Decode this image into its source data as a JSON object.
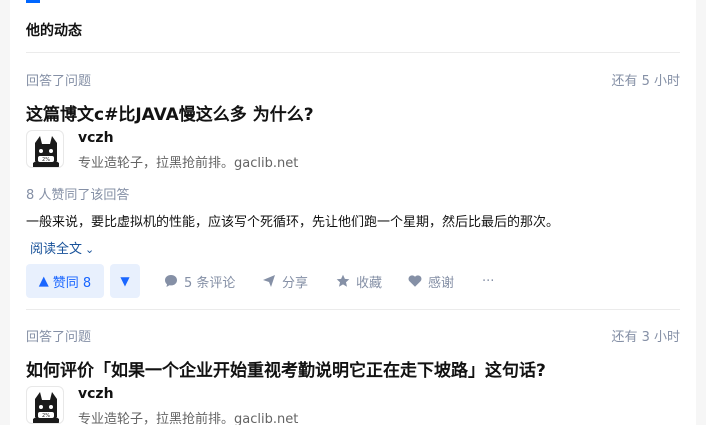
{
  "section": {
    "title": "他的动态"
  },
  "feed": [
    {
      "action": "回答了问题",
      "time": "还有 5 小时",
      "question": "这篇博文c#比JAVA慢这么多 为什么?",
      "author": {
        "name": "vczh",
        "bio": "专业造轮子，拉黑抢前排。gaclib.net",
        "avatar_icon": "cat-avatar-icon"
      },
      "votes_text": "8 人赞同了该回答",
      "excerpt": "一般来说，要比虚拟机的性能，应该写个死循环，先让他们跑一个星期，然后比最后的那次。",
      "read_more": "阅读全文",
      "upvote_label": "赞同 8",
      "comments_label": "5 条评论",
      "share_label": "分享",
      "favorite_label": "收藏",
      "thanks_label": "感谢",
      "more_label": "···"
    },
    {
      "action": "回答了问题",
      "time": "还有 3 小时",
      "question": "如何评价「如果一个企业开始重视考勤说明它正在走下坡路」这句话?",
      "author": {
        "name": "vczh",
        "bio": "专业造轮子，拉黑抢前排。gaclib.net",
        "avatar_icon": "cat-avatar-icon"
      }
    }
  ],
  "colors": {
    "accent": "#0066ff",
    "meta": "#8590a6",
    "vote_bg": "#e8f0fd",
    "link": "#175199"
  }
}
